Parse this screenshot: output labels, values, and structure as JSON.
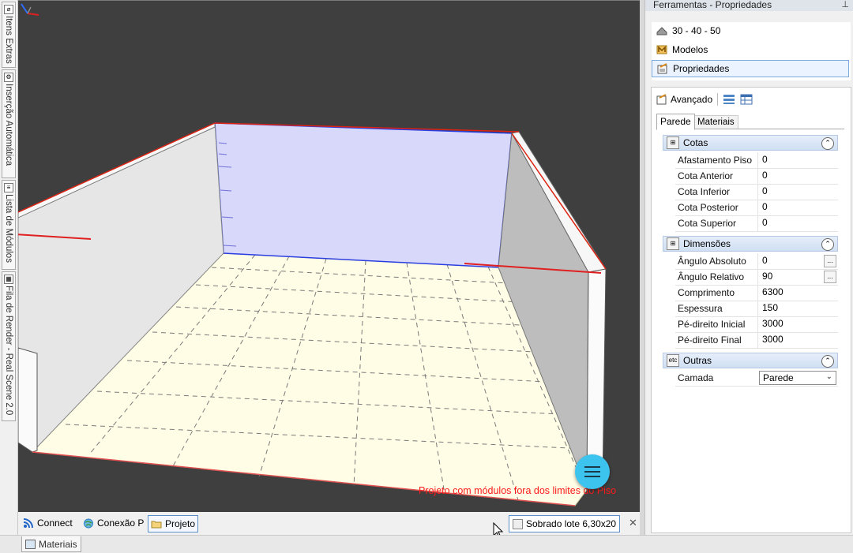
{
  "side_tabs": [
    "Itens Extras",
    "Inserção Automática",
    "Lista de Módulos",
    "Fila de Render - Real Scene 2.0"
  ],
  "viewport": {
    "warning": "Projeto com módulos fora dos limites do Piso"
  },
  "doc_tabs": [
    {
      "label": "Connect",
      "icon": "rss-icon"
    },
    {
      "label": "Conexão P",
      "icon": "globe-icon"
    },
    {
      "label": "Projeto",
      "icon": "folder-icon"
    }
  ],
  "file_tab": {
    "label": "Sobrado lote 6,30x20",
    "close": "✕"
  },
  "bottom_tab": {
    "label": "Materiais"
  },
  "panel": {
    "title": "Ferramentas - Propriedades",
    "pin": "📌",
    "list": [
      {
        "label": "30 - 40 - 50",
        "icon": "roof-icon"
      },
      {
        "label": "Modelos",
        "icon": "models-icon"
      },
      {
        "label": "Propriedades",
        "icon": "properties-icon"
      }
    ],
    "toolbar": {
      "advanced_label": "Avançado"
    },
    "tabs": [
      "Parede",
      "Materiais"
    ],
    "groups": {
      "cotas": {
        "title": "Cotas",
        "rows": [
          {
            "key": "Afastamento Piso",
            "value": "0"
          },
          {
            "key": "Cota Anterior",
            "value": "0"
          },
          {
            "key": "Cota Inferior",
            "value": "0"
          },
          {
            "key": "Cota Posterior",
            "value": "0"
          },
          {
            "key": "Cota Superior",
            "value": "0"
          }
        ]
      },
      "dimensoes": {
        "title": "Dimensões",
        "rows": [
          {
            "key": "Ângulo Absoluto",
            "value": "0"
          },
          {
            "key": "Ângulo Relativo",
            "value": "90"
          },
          {
            "key": "Comprimento",
            "value": "6300"
          },
          {
            "key": "Espessura",
            "value": "150"
          },
          {
            "key": "Pé-direito Inicial",
            "value": "3000"
          },
          {
            "key": "Pé-direito Final",
            "value": "3000"
          }
        ]
      },
      "outras": {
        "title": "Outras",
        "icon_text": "etc",
        "rows": [
          {
            "key": "Camada",
            "value": "Parede"
          }
        ]
      }
    },
    "ellipsis": "..."
  },
  "colors": {
    "viewport_bg": "#3f3f3f",
    "floor": "#fffde5",
    "back_wall": "#d8d8fb",
    "warning": "#ff1a1a",
    "fab": "#3dc4ee"
  }
}
